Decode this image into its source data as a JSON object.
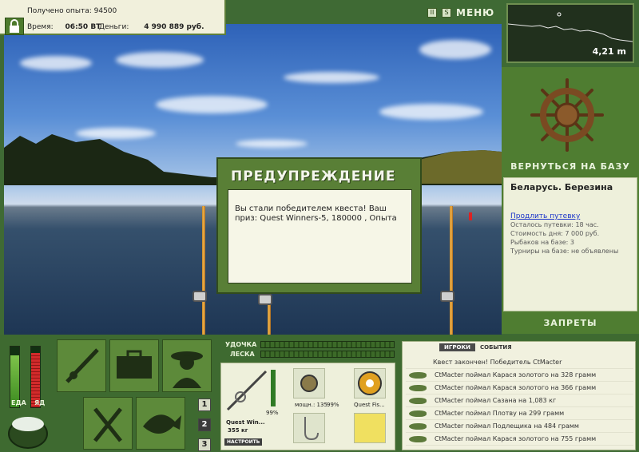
{
  "hud": {
    "exp_label": "Получено опыта:",
    "exp_value": "94500",
    "time_label": "Время:",
    "time_value": "06:50 ВТ",
    "money_label": "Деньги:",
    "money_value": "4 990 889 руб.",
    "menu_label": "МЕНЮ"
  },
  "minimap": {
    "depth": "4,21 m"
  },
  "side": {
    "return_label": "ВЕРНУТЬСЯ НА БАЗУ",
    "location": "Беларусь. Березина",
    "extend_link": "Продлить путевку",
    "lines": [
      "Осталось путевки: 18 час.",
      "Стоимость дня: 7 000 руб.",
      "Рыбаков на базе: 3",
      "Турниры на базе: не объявлены"
    ],
    "ban_label": "ЗАПРЕТЫ"
  },
  "dialog": {
    "title": "ПРЕДУПРЕЖДЕНИЕ",
    "message": "Вы стали победителем квеста! Ваш приз: Quest Winners-5, 180000 , Опыта"
  },
  "needs": {
    "food_label": "ЕДА",
    "poison_label": "ЯД",
    "food_level": 0.85,
    "poison_level": 0.9
  },
  "slots": [
    "1",
    "2",
    "3"
  ],
  "tackle": {
    "rod_label": "УДОЧКА",
    "line_label": "ЛЕСКА",
    "rod_name": "Quest Win...",
    "rod_weight": "355 кг",
    "rod_percent": "99%",
    "reel_info": "мощн.: 135",
    "reel_percent": "99%",
    "line_name": "Quest Fis...",
    "setup_button": "НАСТРОИТЬ"
  },
  "events": {
    "tab_players": "ИГРОКИ",
    "tab_events": "СОБЫТИЯ",
    "items": [
      "Квест закончен! Победитель CtMacter",
      "CtMacter поймал Карася золотого на 328 грамм",
      "CtMacter поймал Карася золотого на 366 грамм",
      "CtMacter поймал Сазана на 1,083 кг",
      "CtMacter поймал Плотву на 299 грамм",
      "CtMacter поймал Подлещика на 484 грамм",
      "CtMacter поймал Карася золотого на 755 грамм"
    ]
  }
}
